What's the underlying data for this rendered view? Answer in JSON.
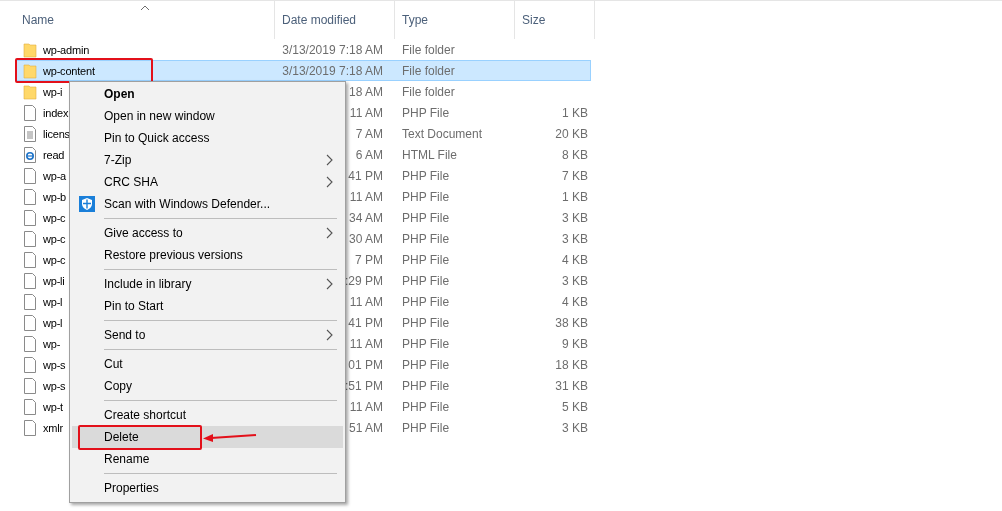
{
  "columns": [
    {
      "label": "Name",
      "sorted": true
    },
    {
      "label": "Date modified",
      "sorted": false
    },
    {
      "label": "Type",
      "sorted": false
    },
    {
      "label": "Size",
      "sorted": false
    }
  ],
  "rows": [
    {
      "kind": "folder",
      "name": "wp-admin",
      "date": "3/13/2019 7:18 AM",
      "type": "File folder",
      "size": "",
      "selected": false,
      "outlined": false
    },
    {
      "kind": "folder",
      "name": "wp-content",
      "date": "3/13/2019 7:18 AM",
      "type": "File folder",
      "size": "",
      "selected": true,
      "outlined": true
    },
    {
      "kind": "folder",
      "name": "wp-i",
      "date": "18 AM",
      "type": "File folder",
      "size": "",
      "selected": false,
      "outlined": false
    },
    {
      "kind": "php",
      "name": "index",
      "date": "11 AM",
      "type": "PHP File",
      "size": "1 KB",
      "selected": false,
      "outlined": false
    },
    {
      "kind": "text",
      "name": "licens",
      "date": "7 AM",
      "type": "Text Document",
      "size": "20 KB",
      "selected": false,
      "outlined": false
    },
    {
      "kind": "html",
      "name": "read",
      "date": "6 AM",
      "type": "HTML File",
      "size": "8 KB",
      "selected": false,
      "outlined": false
    },
    {
      "kind": "php",
      "name": "wp-a",
      "date": "41 PM",
      "type": "PHP File",
      "size": "7 KB",
      "selected": false,
      "outlined": false
    },
    {
      "kind": "php",
      "name": "wp-b",
      "date": "11 AM",
      "type": "PHP File",
      "size": "1 KB",
      "selected": false,
      "outlined": false
    },
    {
      "kind": "php",
      "name": "wp-c",
      "date": "34 AM",
      "type": "PHP File",
      "size": "3 KB",
      "selected": false,
      "outlined": false
    },
    {
      "kind": "php",
      "name": "wp-c",
      "date": "30 AM",
      "type": "PHP File",
      "size": "3 KB",
      "selected": false,
      "outlined": false
    },
    {
      "kind": "php",
      "name": "wp-c",
      "date": "7 PM",
      "type": "PHP File",
      "size": "4 KB",
      "selected": false,
      "outlined": false
    },
    {
      "kind": "php",
      "name": "wp-li",
      "date": ":29 PM",
      "type": "PHP File",
      "size": "3 KB",
      "selected": false,
      "outlined": false
    },
    {
      "kind": "php",
      "name": "wp-l",
      "date": "11 AM",
      "type": "PHP File",
      "size": "4 KB",
      "selected": false,
      "outlined": false
    },
    {
      "kind": "php",
      "name": "wp-l",
      "date": "41 PM",
      "type": "PHP File",
      "size": "38 KB",
      "selected": false,
      "outlined": false
    },
    {
      "kind": "php",
      "name": "wp-",
      "date": "11 AM",
      "type": "PHP File",
      "size": "9 KB",
      "selected": false,
      "outlined": false
    },
    {
      "kind": "php",
      "name": "wp-s",
      "date": "01 PM",
      "type": "PHP File",
      "size": "18 KB",
      "selected": false,
      "outlined": false
    },
    {
      "kind": "php",
      "name": "wp-s",
      "date": ":51 PM",
      "type": "PHP File",
      "size": "31 KB",
      "selected": false,
      "outlined": false
    },
    {
      "kind": "php",
      "name": "wp-t",
      "date": "11 AM",
      "type": "PHP File",
      "size": "5 KB",
      "selected": false,
      "outlined": false
    },
    {
      "kind": "php",
      "name": "xmlr",
      "date": "51 AM",
      "type": "PHP File",
      "size": "3 KB",
      "selected": false,
      "outlined": false
    }
  ],
  "context_menu": {
    "items": [
      {
        "kind": "item",
        "label": "Open",
        "bold": true,
        "submenu": false,
        "selected": false,
        "outlined": false,
        "arrow": false
      },
      {
        "kind": "item",
        "label": "Open in new window",
        "bold": false,
        "submenu": false,
        "selected": false,
        "outlined": false,
        "arrow": false
      },
      {
        "kind": "item",
        "label": "Pin to Quick access",
        "bold": false,
        "submenu": false,
        "selected": false,
        "outlined": false,
        "arrow": false
      },
      {
        "kind": "item",
        "label": "7-Zip",
        "bold": false,
        "submenu": true,
        "selected": false,
        "outlined": false,
        "arrow": false
      },
      {
        "kind": "item",
        "label": "CRC SHA",
        "bold": false,
        "submenu": true,
        "selected": false,
        "outlined": false,
        "arrow": false
      },
      {
        "kind": "scan_item",
        "label": "Scan with Windows Defender...",
        "bold": false,
        "submenu": false,
        "selected": false,
        "outlined": false,
        "arrow": false
      },
      {
        "kind": "separator"
      },
      {
        "kind": "item",
        "label": "Give access to",
        "bold": false,
        "submenu": true,
        "selected": false,
        "outlined": false,
        "arrow": false
      },
      {
        "kind": "item",
        "label": "Restore previous versions",
        "bold": false,
        "submenu": false,
        "selected": false,
        "outlined": false,
        "arrow": false
      },
      {
        "kind": "separator"
      },
      {
        "kind": "item",
        "label": "Include in library",
        "bold": false,
        "submenu": true,
        "selected": false,
        "outlined": false,
        "arrow": false
      },
      {
        "kind": "item",
        "label": "Pin to Start",
        "bold": false,
        "submenu": false,
        "selected": false,
        "outlined": false,
        "arrow": false
      },
      {
        "kind": "separator"
      },
      {
        "kind": "item",
        "label": "Send to",
        "bold": false,
        "submenu": true,
        "selected": false,
        "outlined": false,
        "arrow": false
      },
      {
        "kind": "separator"
      },
      {
        "kind": "item",
        "label": "Cut",
        "bold": false,
        "submenu": false,
        "selected": false,
        "outlined": false,
        "arrow": false
      },
      {
        "kind": "item",
        "label": "Copy",
        "bold": false,
        "submenu": false,
        "selected": false,
        "outlined": false,
        "arrow": false
      },
      {
        "kind": "separator"
      },
      {
        "kind": "item",
        "label": "Create shortcut",
        "bold": false,
        "submenu": false,
        "selected": false,
        "outlined": false,
        "arrow": false
      },
      {
        "kind": "item",
        "label": "Delete",
        "bold": false,
        "submenu": false,
        "selected": true,
        "outlined": true,
        "arrow": true
      },
      {
        "kind": "item",
        "label": "Rename",
        "bold": false,
        "submenu": false,
        "selected": false,
        "outlined": false,
        "arrow": false
      },
      {
        "kind": "separator"
      },
      {
        "kind": "item",
        "label": "Properties",
        "bold": false,
        "submenu": false,
        "selected": false,
        "outlined": false,
        "arrow": false
      }
    ]
  }
}
